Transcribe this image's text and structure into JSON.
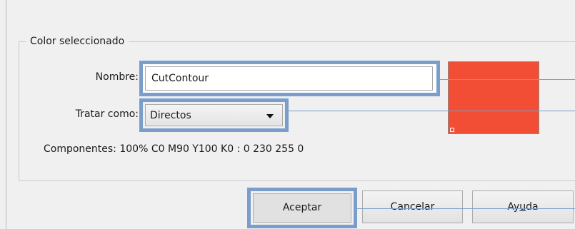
{
  "group": {
    "title": "Color seleccionado"
  },
  "name_row": {
    "label": "Nombre:",
    "value": "CutContour"
  },
  "treat_row": {
    "label": "Tratar como:",
    "selected": "Directos"
  },
  "components_row": {
    "text": "Componentes: 100% C0 M90 Y100 K0 : 0 230 255 0"
  },
  "swatch": {
    "color": "#f14e35"
  },
  "highlight": {
    "color": "#7a9dcb"
  },
  "buttons": {
    "accept": "Aceptar",
    "cancel": "Cancelar",
    "help_pre": "Ay",
    "help_mnemonic": "u",
    "help_post": "da"
  }
}
